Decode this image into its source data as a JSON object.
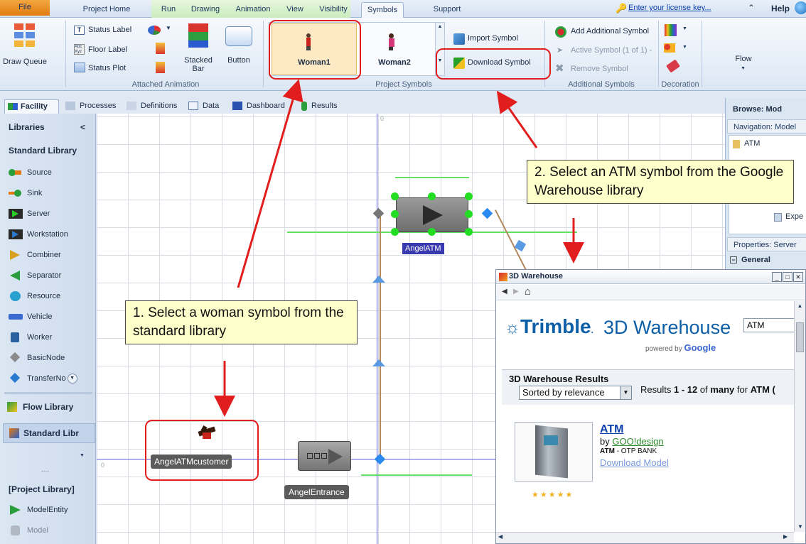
{
  "menu": {
    "file": "File",
    "tabs": [
      "Project Home",
      "Run",
      "Drawing",
      "Animation",
      "View",
      "Visibility",
      "Symbols",
      "Support"
    ],
    "license_link": "Enter your license key...",
    "help": "Help"
  },
  "ribbon": {
    "draw_queue": "Draw Queue",
    "status_label": "Status Label",
    "floor_label": "Floor Label",
    "status_plot": "Status Plot",
    "stacked_bar": "Stacked Bar",
    "button": "Button",
    "attached_animation": "Attached Animation",
    "woman1": "Woman1",
    "woman2": "Woman2",
    "import_symbol": "Import Symbol",
    "download_symbol": "Download Symbol",
    "project_symbols": "Project Symbols",
    "add_additional_symbol": "Add Additional Symbol",
    "active_symbol": "Active Symbol (1 of 1) -",
    "remove_symbol": "Remove Symbol",
    "additional_symbols": "Additional Symbols",
    "decoration": "Decoration",
    "flow": "Flow"
  },
  "view_tabs": [
    "Facility",
    "Processes",
    "Definitions",
    "Data",
    "Dashboard",
    "Results"
  ],
  "left_panel": {
    "libraries": "Libraries",
    "collapse": "<",
    "standard_library_heading": "Standard Library",
    "items": [
      "Source",
      "Sink",
      "Server",
      "Workstation",
      "Combiner",
      "Separator",
      "Resource",
      "Vehicle",
      "Worker",
      "BasicNode",
      "TransferNo"
    ],
    "flow_library": "Flow Library",
    "standard_library_tab": "Standard Libr",
    "dots": "....",
    "project_library": "[Project Library]",
    "project_items": [
      "ModelEntity",
      "Model"
    ]
  },
  "canvas": {
    "server_label": "AngelATM",
    "entity_label": "AngelATMcustomer",
    "source_label": "AngelEntrance",
    "origin_small": "0"
  },
  "right_panel": {
    "browse": "Browse: Mod",
    "navigation": "Navigation: Model",
    "atm": "ATM",
    "expe": "Expe",
    "properties": "Properties: Server",
    "general": "General"
  },
  "warehouse": {
    "title": "3D Warehouse",
    "brand": "Trimble",
    "product": "3D Warehouse",
    "powered_by": "powered by",
    "google": "Google",
    "search_value": "ATM",
    "results_heading": "3D Warehouse Results",
    "sort_option": "Sorted by relevance",
    "results_prefix": "Results",
    "results_range": "1 - 12",
    "results_of": "of",
    "results_many": "many",
    "results_for": "for",
    "results_query": "ATM (",
    "item_title": "ATM",
    "item_by": "by",
    "item_author": "GOO!design",
    "item_sub_strong": "ATM",
    "item_sub_rest": "- OTP BANK",
    "item_download": "Download Model",
    "stars": "★★★★★"
  },
  "callouts": {
    "step1": "1. Select a woman symbol from the standard library",
    "step2": "2. Select an ATM symbol from the Google Warehouse library"
  },
  "colors": {
    "accent_red": "#e21d1d",
    "callout_bg": "#ffffcc",
    "link_blue": "#0a3ea8",
    "selection_green": "#22dd22"
  }
}
